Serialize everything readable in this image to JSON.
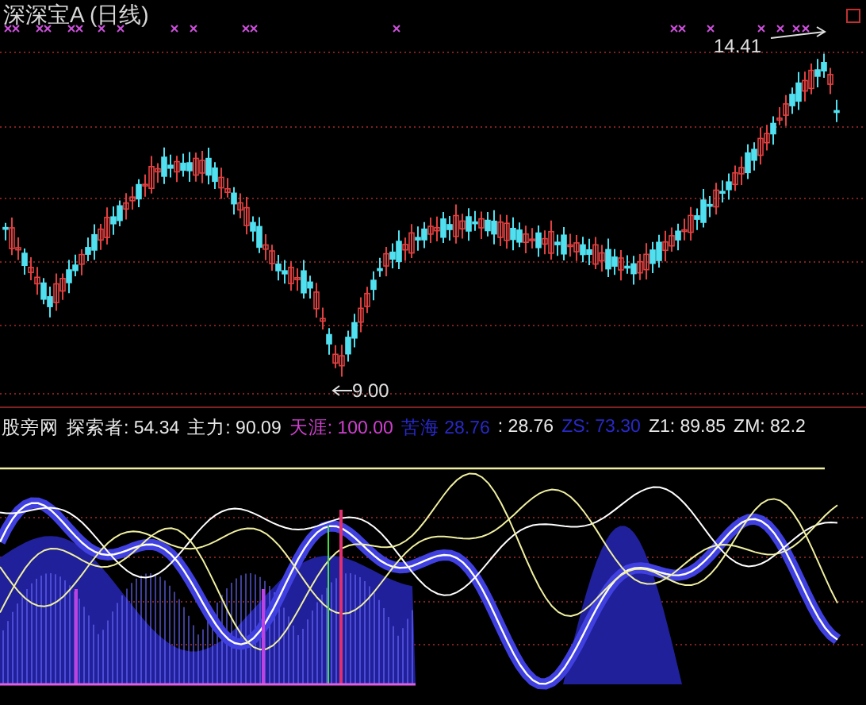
{
  "price_panel": {
    "title": "深深宝A (日线)",
    "high_label": "14.41",
    "low_label": "9.00"
  },
  "indicator_panel": {
    "name": "股旁网",
    "legend": [
      {
        "text": "探索者: 54.34",
        "color": "#e8e8e8"
      },
      {
        "text": "主力: 90.09",
        "color": "#e8e8e8"
      },
      {
        "text": "天涯: 100.00",
        "color": "#d040d0"
      },
      {
        "text": "苦海 28.76",
        "color": "#2828c8"
      },
      {
        "text": ": 28.76",
        "color": "#e8e8e8"
      },
      {
        "text": "ZS: 73.30",
        "color": "#2828c8"
      },
      {
        "text": "Z1: 89.85",
        "color": "#e8e8e8"
      },
      {
        "text": "ZM: 82.2",
        "color": "#e8e8e8"
      }
    ]
  }
}
